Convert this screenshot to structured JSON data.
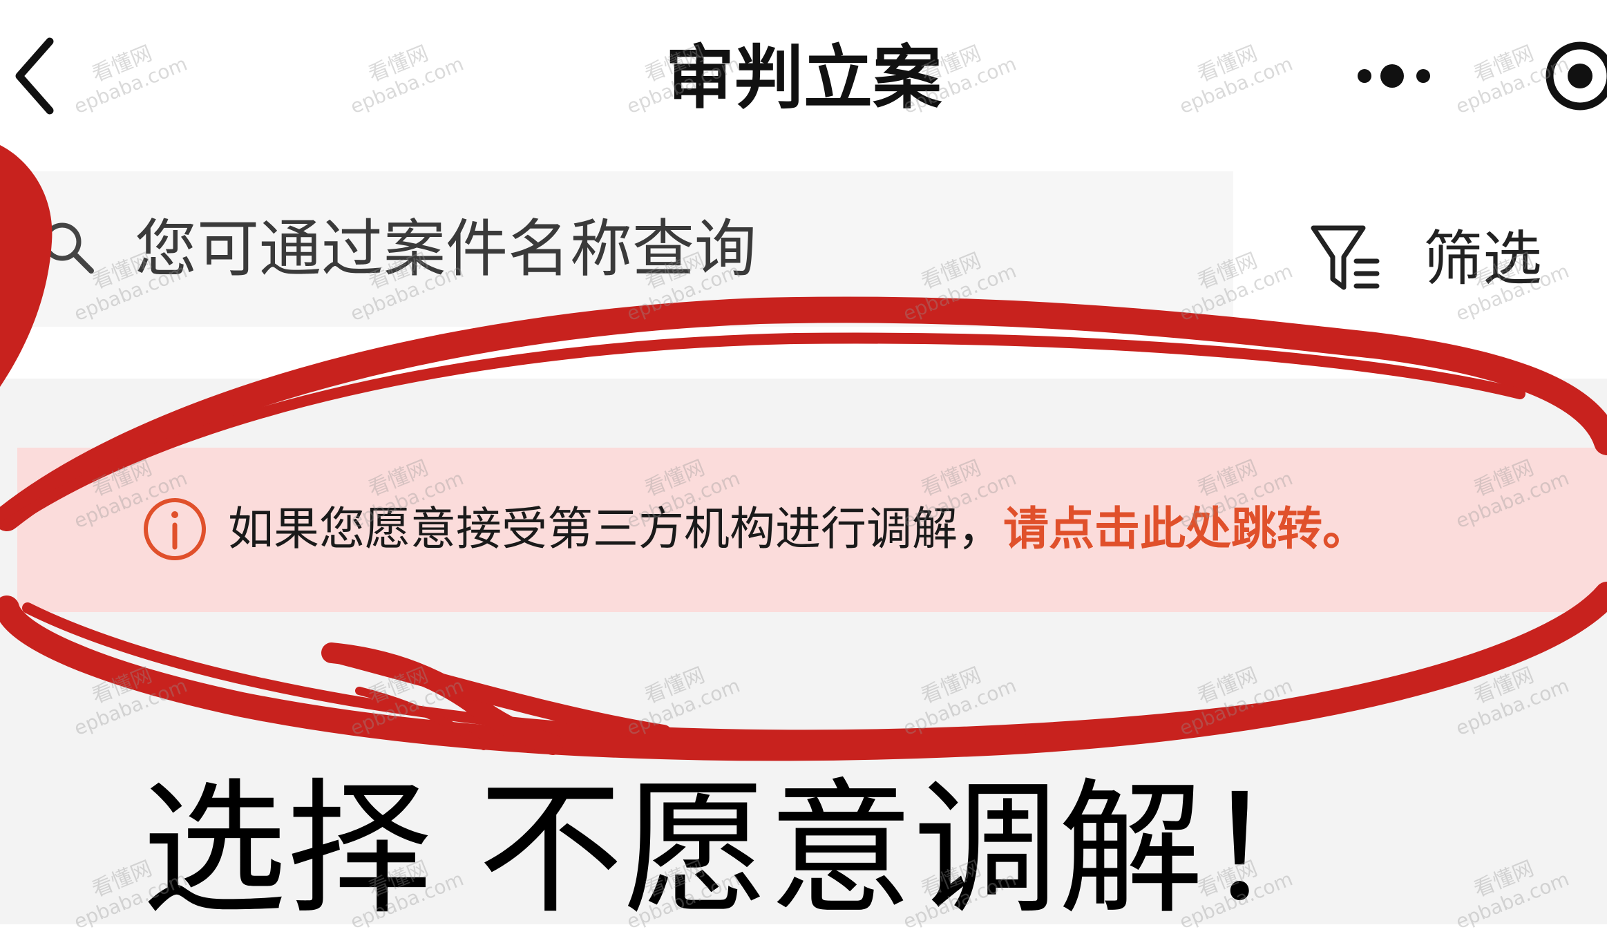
{
  "header": {
    "title": "审判立案",
    "back_icon": "chevron-left-icon",
    "more_icon": "more-dots-icon",
    "close_icon": "target-circle-icon"
  },
  "search": {
    "placeholder": "您可通过案件名称查询",
    "icon": "search-icon"
  },
  "filter": {
    "label": "筛选",
    "icon": "filter-icon"
  },
  "notice": {
    "icon": "info-circle-icon",
    "text": "如果您愿意接受第三方机构进行调解，",
    "link": "请点击此处跳转。"
  },
  "caption": "选择 不愿意调解！",
  "watermark": {
    "line1": "看懂网",
    "line2": "epbaba.com"
  },
  "colors": {
    "notice_bg": "#fbdcdb",
    "notice_link": "#e0502b",
    "annotation_red": "#c8221e"
  }
}
